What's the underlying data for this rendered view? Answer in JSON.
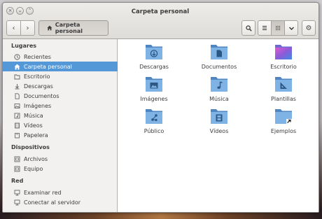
{
  "window": {
    "title": "Carpeta personal"
  },
  "toolbar": {
    "back_icon": "chevron-left-icon",
    "forward_icon": "chevron-right-icon",
    "path_label": "Carpeta personal",
    "search_icon": "search-icon",
    "list_view_icon": "list-icon",
    "grid_view_icon": "grid-icon",
    "menu_icon": "chevron-down-icon",
    "settings_icon": "gear-icon"
  },
  "sidebar": {
    "sections": [
      {
        "header": "Lugares",
        "items": [
          {
            "label": "Recientes",
            "icon": "clock-icon"
          },
          {
            "label": "Carpeta personal",
            "icon": "home-icon",
            "selected": true
          },
          {
            "label": "Escritorio",
            "icon": "desktop-folder-icon"
          },
          {
            "label": "Descargas",
            "icon": "download-icon"
          },
          {
            "label": "Documentos",
            "icon": "document-icon"
          },
          {
            "label": "Imágenes",
            "icon": "image-icon"
          },
          {
            "label": "Música",
            "icon": "music-icon"
          },
          {
            "label": "Vídeos",
            "icon": "video-icon"
          },
          {
            "label": "Papelera",
            "icon": "trash-icon"
          }
        ]
      },
      {
        "header": "Dispositivos",
        "items": [
          {
            "label": "Archivos",
            "icon": "drive-icon"
          },
          {
            "label": "Equipo",
            "icon": "computer-icon"
          }
        ]
      },
      {
        "header": "Red",
        "items": [
          {
            "label": "Examinar red",
            "icon": "network-icon"
          },
          {
            "label": "Conectar al servidor",
            "icon": "server-icon"
          }
        ]
      }
    ]
  },
  "files": [
    {
      "label": "Descargas",
      "icon": "download-folder-icon"
    },
    {
      "label": "Documentos",
      "icon": "documents-folder-icon"
    },
    {
      "label": "Escritorio",
      "icon": "desktop-folder-icon"
    },
    {
      "label": "Imágenes",
      "icon": "pictures-folder-icon"
    },
    {
      "label": "Música",
      "icon": "music-folder-icon"
    },
    {
      "label": "Plantillas",
      "icon": "templates-folder-icon"
    },
    {
      "label": "Público",
      "icon": "public-folder-icon"
    },
    {
      "label": "Vídeos",
      "icon": "videos-folder-icon"
    },
    {
      "label": "Ejemplos",
      "icon": "examples-folder-link-icon"
    }
  ],
  "colors": {
    "selection": "#5598d7",
    "folder_light": "#7fb2e5",
    "folder_dark": "#4f86c1"
  }
}
